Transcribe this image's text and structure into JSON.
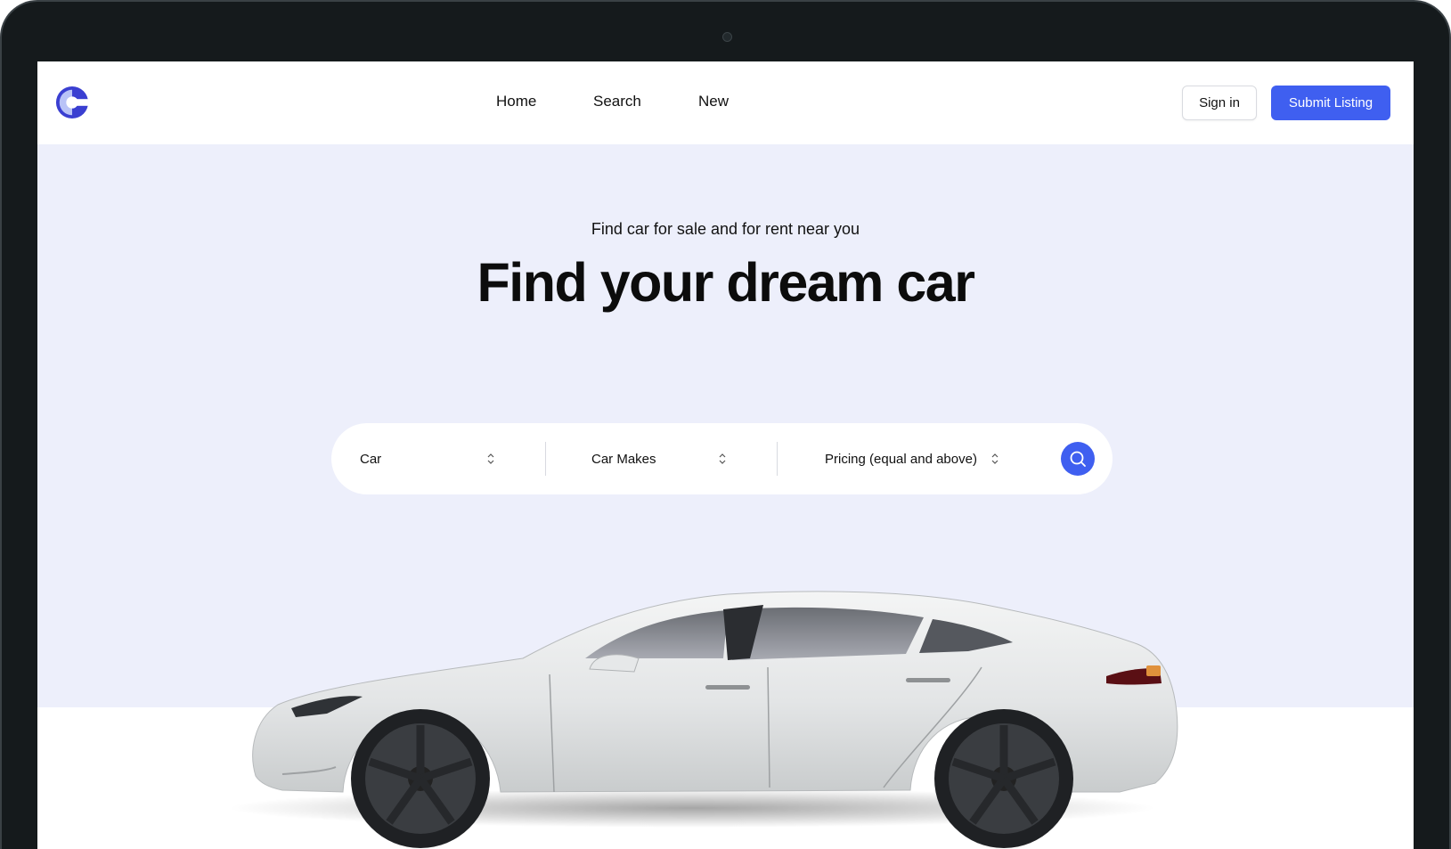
{
  "nav": {
    "logo_icon": "brand-c-logo",
    "links": [
      "Home",
      "Search",
      "New"
    ],
    "sign_in": "Sign in",
    "submit_listing": "Submit Listing"
  },
  "hero": {
    "subtitle": "Find car for sale and for rent near you",
    "title": "Find your dream car"
  },
  "search": {
    "type_value": "Car",
    "make_value": "Car Makes",
    "price_value": "Pricing (equal and above)",
    "button_icon": "search-icon"
  },
  "colors": {
    "accent": "#3f5ff0",
    "hero_background": "#edeffb",
    "logo_dark": "#3a3fd1",
    "logo_light": "#b9c3f7"
  }
}
